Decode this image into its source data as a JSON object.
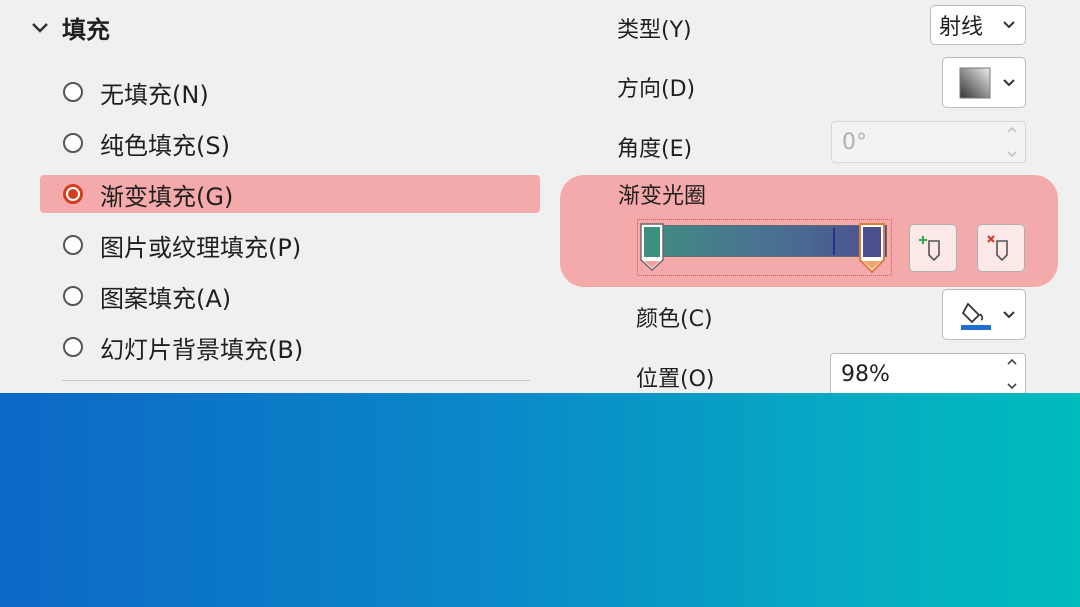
{
  "section": {
    "title": "填充",
    "icon": "chevron-down-icon"
  },
  "fill_options": [
    {
      "label": "无填充(N)",
      "selected": false
    },
    {
      "label": "纯色填充(S)",
      "selected": false
    },
    {
      "label": "渐变填充(G)",
      "selected": true
    },
    {
      "label": "图片或纹理填充(P)",
      "selected": false
    },
    {
      "label": "图案填充(A)",
      "selected": false
    },
    {
      "label": "幻灯片背景填充(B)",
      "selected": false
    }
  ],
  "type": {
    "label": "类型(Y)",
    "value": "射线"
  },
  "direction": {
    "label": "方向(D)",
    "icon": "gradient-direction-icon"
  },
  "angle": {
    "label": "角度(E)",
    "value": "0°",
    "disabled": true
  },
  "gradient_stops": {
    "label": "渐变光圈",
    "add_icon": "add-gradient-stop-icon",
    "remove_icon": "remove-gradient-stop-icon",
    "colors": [
      "#3f8e82",
      "#4b4f8e"
    ]
  },
  "color": {
    "label": "颜色(C)",
    "icon": "paint-bucket-icon",
    "accent": "#1f6fd0"
  },
  "position": {
    "label": "位置(O)",
    "value": "98%"
  },
  "preview_gradient": [
    "#0c68c6",
    "#00bcbd"
  ],
  "colors": {
    "highlight": "#f4aaaa",
    "radio_selected": "#d43d1e"
  }
}
